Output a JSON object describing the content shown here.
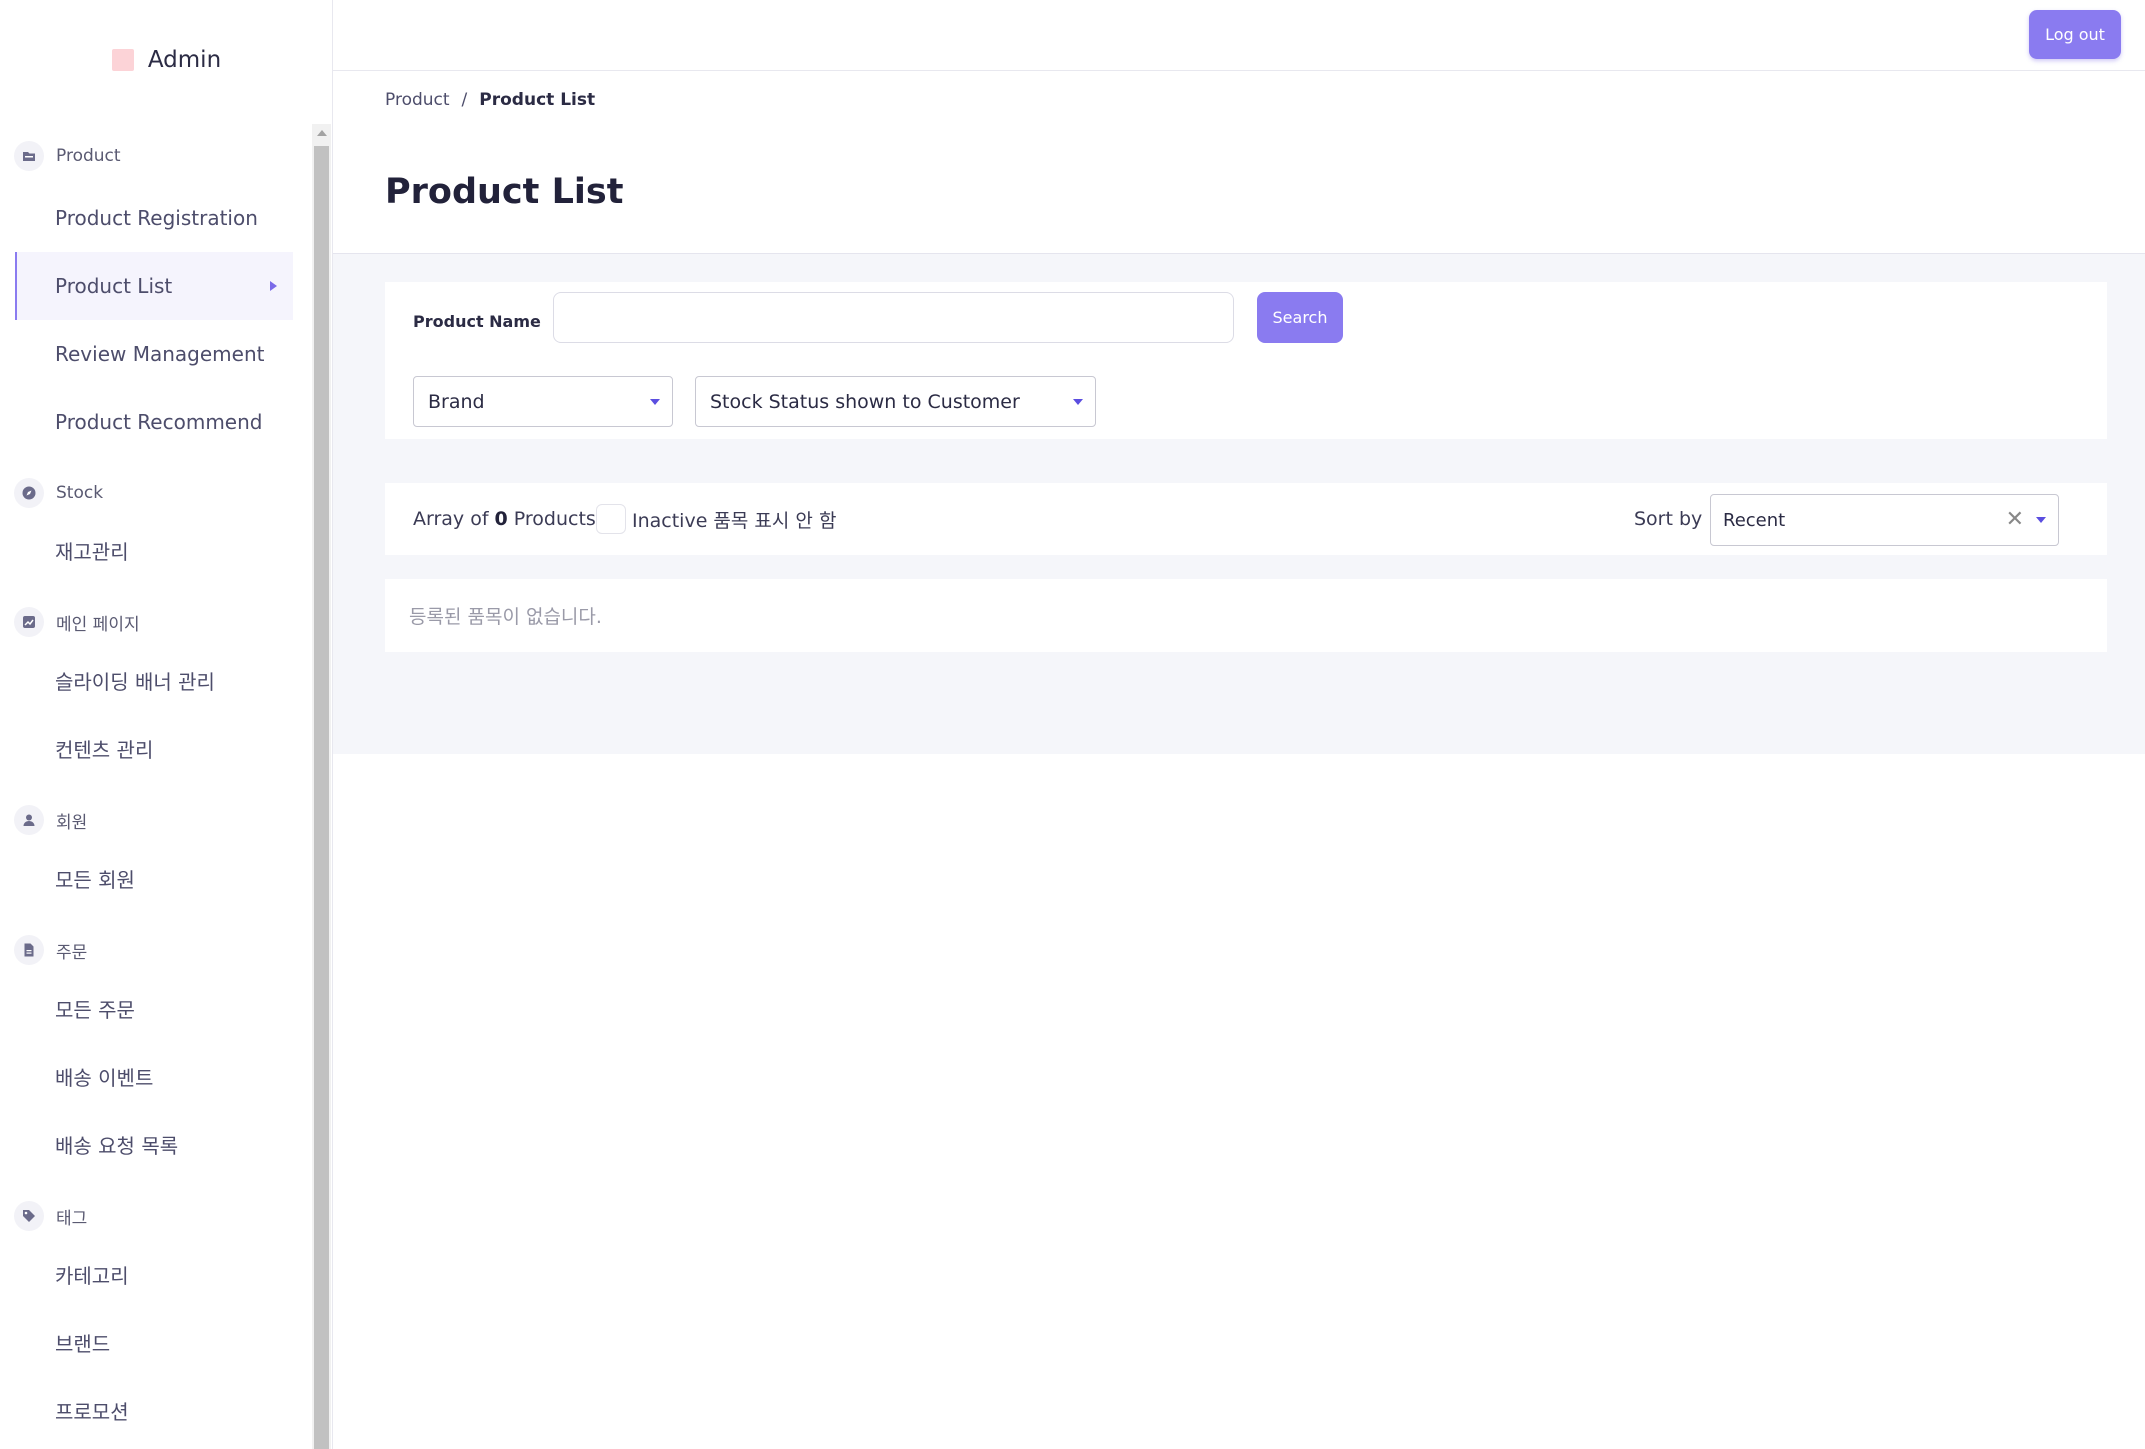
{
  "app": {
    "name": "Admin",
    "logo_color": "#fcd3d7"
  },
  "topbar": {
    "logout_label": "Log out"
  },
  "sidebar": {
    "groups": [
      {
        "label": "Product",
        "icon": "folder-icon",
        "items": [
          "Product Registration",
          "Product List",
          "Review Management",
          "Product Recommend"
        ]
      },
      {
        "label": "Stock",
        "icon": "compass-icon",
        "items": [
          "재고관리"
        ]
      },
      {
        "label": "메인 페이지",
        "icon": "chart-icon",
        "items": [
          "슬라이딩 배너 관리",
          "컨텐츠 관리"
        ]
      },
      {
        "label": "회원",
        "icon": "user-icon",
        "items": [
          "모든 회원"
        ]
      },
      {
        "label": "주문",
        "icon": "document-icon",
        "items": [
          "모든 주문",
          "배송 이벤트",
          "배송 요청 목록"
        ]
      },
      {
        "label": "태그",
        "icon": "tag-icon",
        "items": [
          "카테고리",
          "브랜드",
          "프로모션"
        ]
      }
    ],
    "active_item": "Product List"
  },
  "breadcrumb": {
    "parent": "Product",
    "separator": "/",
    "current": "Product List"
  },
  "page": {
    "title": "Product List"
  },
  "filters": {
    "name_label": "Product Name",
    "name_value": "",
    "search_label": "Search",
    "brand_select": "Brand",
    "stock_select": "Stock Status shown to Customer"
  },
  "list_bar": {
    "prefix": "Array of",
    "count": "0",
    "suffix": "Products",
    "inactive_label": "Inactive 품목 표시 안 함",
    "inactive_checked": false,
    "sort_label": "Sort by",
    "sort_value": "Recent"
  },
  "empty_message": "등록된 품목이 없습니다.",
  "colors": {
    "accent": "#8a7bf0",
    "accent_dark": "#5b4ee0",
    "content_bg": "#f5f6fa",
    "active_nav_bg": "#f5f4fd"
  }
}
